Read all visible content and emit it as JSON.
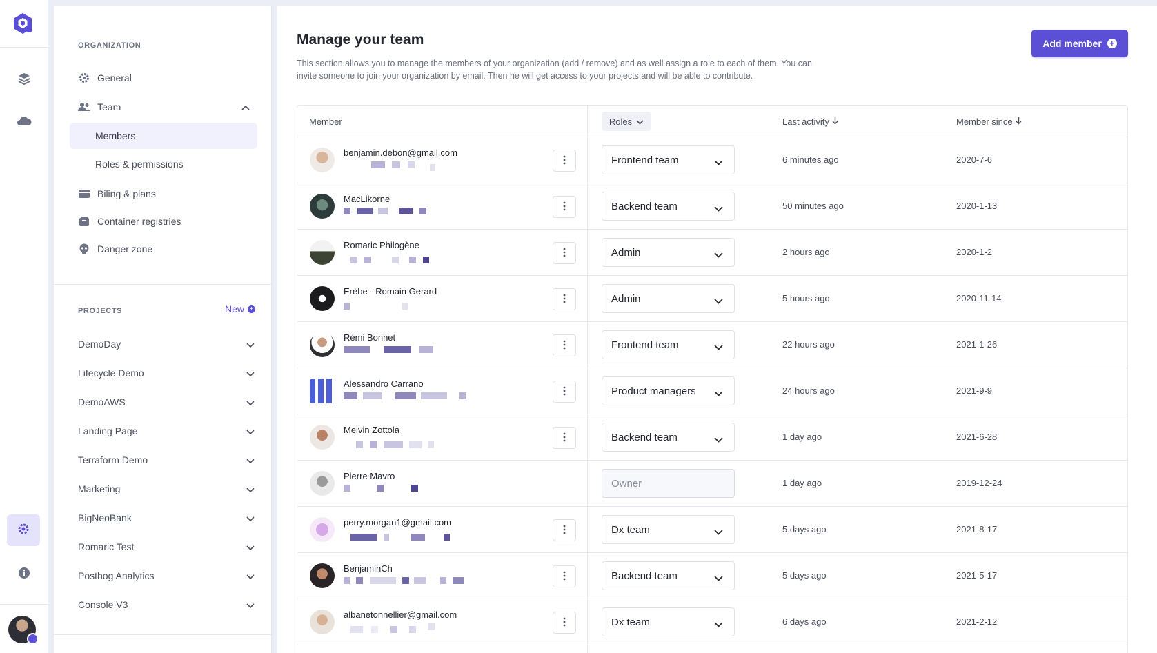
{
  "colors": {
    "accent": "#5b4fd6",
    "accent_soft": "#f1f0fd",
    "background": "#eceef7",
    "text": "#23262f",
    "muted": "#6c7080"
  },
  "rail": {
    "icons": [
      "qovery-logo-icon",
      "layers-icon",
      "cloud-icon",
      "gear-icon",
      "info-icon"
    ]
  },
  "sidebar": {
    "org_label": "ORGANIZATION",
    "items": [
      {
        "label": "General",
        "icon": "gear-icon"
      },
      {
        "label": "Team",
        "icon": "users-icon"
      },
      {
        "label": "Biling & plans",
        "icon": "credit-card-icon"
      },
      {
        "label": "Container registries",
        "icon": "box-icon"
      },
      {
        "label": "Danger zone",
        "icon": "skull-icon"
      }
    ],
    "team_sub": [
      {
        "label": "Members",
        "active": true
      },
      {
        "label": "Roles & permissions",
        "active": false
      }
    ],
    "projects_label": "PROJECTS",
    "new_label": "New",
    "projects": [
      "DemoDay",
      "Lifecycle Demo",
      "DemoAWS",
      "Landing Page",
      "Terraform Demo",
      "Marketing",
      "BigNeoBank",
      "Romaric Test",
      "Posthog Analytics",
      "Console V3"
    ]
  },
  "main": {
    "title": "Manage your team",
    "description": "This section allows you to manage the members of your organization (add / remove) and as well assign a role to each of them. You can invite someone to join your organization by email. Then he will get access to your projects and will be able to contribute.",
    "add_button": "Add member"
  },
  "table": {
    "headers": {
      "member": "Member",
      "roles": "Roles",
      "last_activity": "Last activity",
      "member_since": "Member since"
    },
    "rows": [
      {
        "name": "benjamin.debon@gmail.com",
        "role": "Frontend team",
        "activity": "6 minutes ago",
        "since": "2020-7-6"
      },
      {
        "name": "MacLikorne",
        "role": "Backend team",
        "activity": "50 minutes ago",
        "since": "2020-1-13"
      },
      {
        "name": "Romaric Philogène",
        "role": "Admin",
        "activity": "2 hours ago",
        "since": "2020-1-2"
      },
      {
        "name": "Erèbe - Romain Gerard",
        "role": "Admin",
        "activity": "5 hours ago",
        "since": "2020-11-14"
      },
      {
        "name": "Rémi Bonnet",
        "role": "Frontend team",
        "activity": "22 hours ago",
        "since": "2021-1-26"
      },
      {
        "name": "Alessandro Carrano",
        "role": "Product managers",
        "activity": "24 hours ago",
        "since": "2021-9-9"
      },
      {
        "name": "Melvin Zottola",
        "role": "Backend team",
        "activity": "1 day ago",
        "since": "2021-6-28"
      },
      {
        "name": "Pierre Mavro",
        "role": "Owner",
        "activity": "1 day ago",
        "since": "2019-12-24"
      },
      {
        "name": "perry.morgan1@gmail.com",
        "role": "Dx team",
        "activity": "5 days ago",
        "since": "2021-8-17"
      },
      {
        "name": "BenjaminCh",
        "role": "Backend team",
        "activity": "5 days ago",
        "since": "2021-5-17"
      },
      {
        "name": "albanetonnellier@gmail.com",
        "role": "Dx team",
        "activity": "6 days ago",
        "since": "2021-2-12"
      }
    ]
  }
}
